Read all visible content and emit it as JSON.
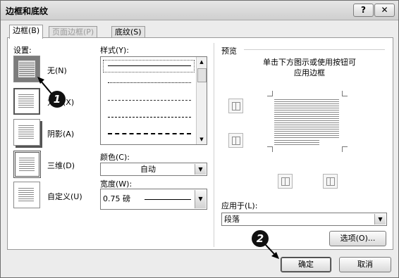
{
  "window": {
    "title": "边框和底纹",
    "help_label": "?",
    "close_label": "✕"
  },
  "tabs": [
    {
      "label": "边框(B)",
      "state": "active"
    },
    {
      "label": "页面边框(P)",
      "state": "disabled"
    },
    {
      "label": "底纹(S)",
      "state": "normal"
    }
  ],
  "settings": {
    "label": "设置:",
    "options": [
      {
        "label": "无(N)",
        "selected": true
      },
      {
        "label": "方框(X)",
        "selected": false
      },
      {
        "label": "阴影(A)",
        "selected": false
      },
      {
        "label": "三维(D)",
        "selected": false
      },
      {
        "label": "自定义(U)",
        "selected": false
      }
    ]
  },
  "style": {
    "label": "样式(Y):",
    "lines": [
      "solid",
      "dotted",
      "dashed-fine",
      "dashed",
      "dash-dot"
    ]
  },
  "color": {
    "label": "颜色(C):",
    "value": "自动"
  },
  "width": {
    "label": "宽度(W):",
    "value": "0.75 磅"
  },
  "preview": {
    "label": "预览",
    "hint_line1": "单击下方图示或使用按钮可",
    "hint_line2": "应用边框"
  },
  "apply_to": {
    "label": "应用于(L):",
    "value": "段落"
  },
  "buttons": {
    "options": "选项(O)...",
    "ok": "确定",
    "cancel": "取消"
  },
  "callouts": {
    "first": "1",
    "second": "2"
  }
}
